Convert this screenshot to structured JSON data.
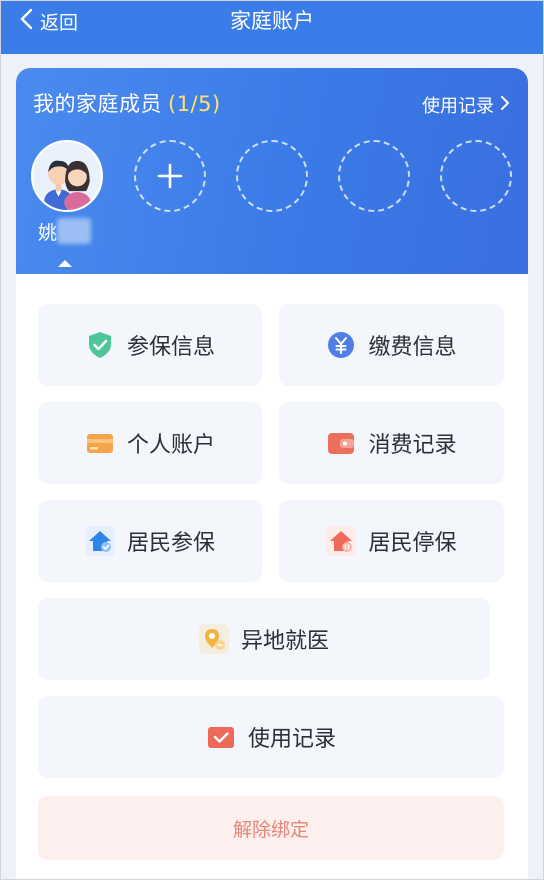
{
  "header": {
    "back_label": "返回",
    "title": "家庭账户"
  },
  "members": {
    "title": "我的家庭成员",
    "count": "(1/5)",
    "usage_link": "使用记录",
    "current_member_name": "姚",
    "add_symbol": "+"
  },
  "menu": {
    "insurance_info": "参保信息",
    "payment_info": "缴费信息",
    "personal_account": "个人账户",
    "consumption_records": "消费记录",
    "resident_enroll": "居民参保",
    "resident_suspend": "居民停保",
    "remote_medical": "异地就医",
    "usage_records": "使用记录",
    "unbind": "解除绑定"
  },
  "icons": {
    "back": "chevron-left-icon",
    "usage_arrow": "chevron-right-icon",
    "insurance": "shield-check-icon",
    "payment": "yen-coin-icon",
    "account": "card-icon",
    "consumption": "wallet-icon",
    "enroll": "house-check-icon",
    "suspend": "house-pause-icon",
    "remote": "location-tag-icon",
    "records": "checked-envelope-icon"
  },
  "colors": {
    "header_blue": "#3b7de8",
    "count_yellow": "#ffe26a",
    "tile_bg": "#f3f6fb",
    "danger_text": "#e8857a",
    "danger_bg": "#fdefee"
  }
}
